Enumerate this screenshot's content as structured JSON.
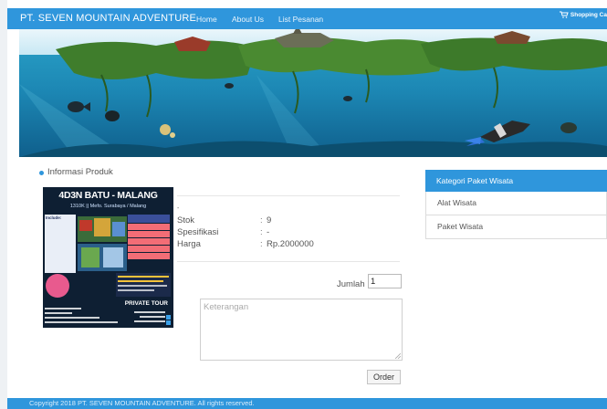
{
  "navbar": {
    "brand": "PT. SEVEN MOUNTAIN ADVENTURE",
    "links": [
      {
        "label": "Home"
      },
      {
        "label": "About Us"
      },
      {
        "label": "List Pesanan"
      }
    ],
    "cart_label": "Shopping Ca",
    "cart_icon": "cart-icon"
  },
  "product": {
    "section_title": "Informasi Produk",
    "image": {
      "title": "4D3N BATU - MALANG",
      "subtitle": "1310K || Mefo. Surabaya / Malang",
      "includes_title": "Include:",
      "private_label": "PRIVATE TOUR"
    },
    "dash": "-",
    "specs": [
      {
        "label": "Stok",
        "colon": ":",
        "value": "9"
      },
      {
        "label": "Spesifikasi",
        "colon": ":",
        "value": "-"
      },
      {
        "label": "Harga",
        "colon": ":",
        "value": "Rp.2000000"
      }
    ]
  },
  "order_form": {
    "qty_label": "Jumlah :",
    "qty_value": "1",
    "note_placeholder": "Keterangan",
    "order_button": "Order"
  },
  "sidebar": {
    "header": "Kategori Paket Wisata",
    "items": [
      {
        "label": "Alat Wisata"
      },
      {
        "label": "Paket Wisata"
      }
    ]
  },
  "footer": {
    "text": "Copyright 2018 PT. SEVEN MOUNTAIN ADVENTURE. All rights reserved."
  },
  "colors": {
    "primary": "#2f96dc",
    "text": "#555555"
  }
}
